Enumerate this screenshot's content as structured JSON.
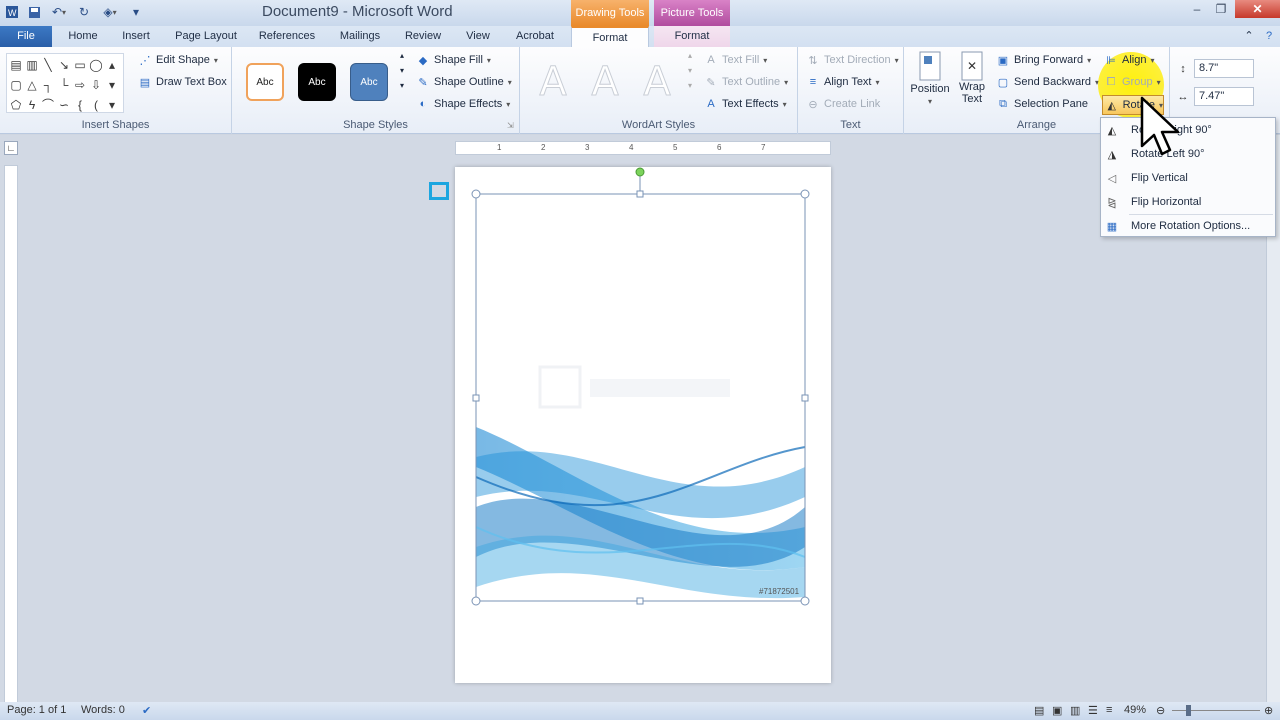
{
  "window": {
    "title": "Document9 - Microsoft Word",
    "context_groups": [
      "Drawing Tools",
      "Picture Tools"
    ]
  },
  "tabs": [
    "File",
    "Home",
    "Insert",
    "Page Layout",
    "References",
    "Mailings",
    "Review",
    "View",
    "Acrobat",
    "Format",
    "Format"
  ],
  "ribbon": {
    "insert_shapes": {
      "label": "Insert Shapes",
      "edit_shape": "Edit Shape",
      "draw_text_box": "Draw Text Box"
    },
    "shape_styles": {
      "label": "Shape Styles",
      "swatches": [
        "Abc",
        "Abc",
        "Abc"
      ],
      "shape_fill": "Shape Fill",
      "shape_outline": "Shape Outline",
      "shape_effects": "Shape Effects"
    },
    "wordart": {
      "label": "WordArt Styles",
      "letters": [
        "A",
        "A",
        "A"
      ],
      "text_fill": "Text Fill",
      "text_outline": "Text Outline",
      "text_effects": "Text Effects"
    },
    "text": {
      "label": "Text",
      "text_direction": "Text Direction",
      "align_text": "Align Text",
      "create_link": "Create Link"
    },
    "arrange": {
      "label": "Arrange",
      "position": "Position",
      "wrap_text": "Wrap Text",
      "bring_forward": "Bring Forward",
      "send_backward": "Send Backward",
      "selection_pane": "Selection Pane",
      "align": "Align",
      "group": "Group",
      "rotate": "Rotate"
    },
    "size": {
      "height": "8.7\"",
      "width": "7.47\""
    }
  },
  "rotate_menu": [
    "Rotate Right 90°",
    "Rotate Left 90°",
    "Flip Vertical",
    "Flip Horizontal",
    "More Rotation Options..."
  ],
  "page": {
    "watermark_code": "#71872501"
  },
  "ruler": [
    "1",
    "2",
    "3",
    "4",
    "5",
    "6",
    "7"
  ],
  "status": {
    "page": "Page: 1 of 1",
    "words": "Words: 0",
    "zoom": "49%"
  }
}
